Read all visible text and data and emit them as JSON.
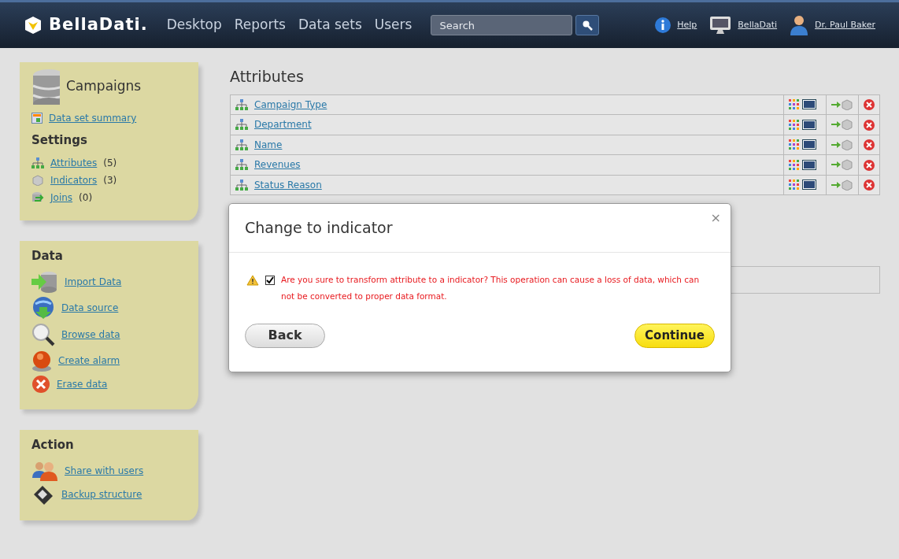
{
  "navbar": {
    "brand": "BellaDati.",
    "links": [
      "Desktop",
      "Reports",
      "Data sets",
      "Users"
    ],
    "search": {
      "placeholder": "Search"
    },
    "right": [
      {
        "kind": "help",
        "label": "Help"
      },
      {
        "kind": "monitor",
        "label": "BellaDati"
      },
      {
        "kind": "user",
        "label": "Dr. Paul Baker"
      }
    ]
  },
  "sidebar": {
    "dataset": {
      "title": "Campaigns",
      "summary": "Data set summary"
    },
    "sections": [
      {
        "title": "Settings",
        "items": [
          {
            "kind": "attribute",
            "label": "Attributes",
            "count": "(5)"
          },
          {
            "kind": "indicator",
            "label": "Indicators",
            "count": "(3)"
          },
          {
            "kind": "join",
            "label": "Joins",
            "count": "(0)"
          }
        ]
      },
      {
        "title": "Data",
        "items": [
          {
            "kind": "import",
            "label": "Import Data"
          },
          {
            "kind": "source",
            "label": "Data source"
          },
          {
            "kind": "browse",
            "label": "Browse data"
          },
          {
            "kind": "alarm",
            "label": "Create alarm"
          },
          {
            "kind": "erase",
            "label": "Erase data"
          }
        ]
      },
      {
        "title": "Action",
        "items": [
          {
            "kind": "share",
            "label": "Share with users"
          },
          {
            "kind": "backup",
            "label": "Backup structure"
          }
        ]
      }
    ]
  },
  "attributes": {
    "title": "Attributes",
    "rows": [
      "Campaign Type",
      "Department",
      "Name",
      "Revenues",
      "Status Reason"
    ]
  },
  "modal": {
    "title": "Change to indicator",
    "close": "×",
    "checked": true,
    "message": "Are you sure to transform attribute to a indicator? This operation can cause a loss of data, which can not be converted to proper data format.",
    "buttons": [
      {
        "kind": "secondary",
        "label": "Back"
      },
      {
        "kind": "primary",
        "label": "Continue"
      }
    ]
  }
}
